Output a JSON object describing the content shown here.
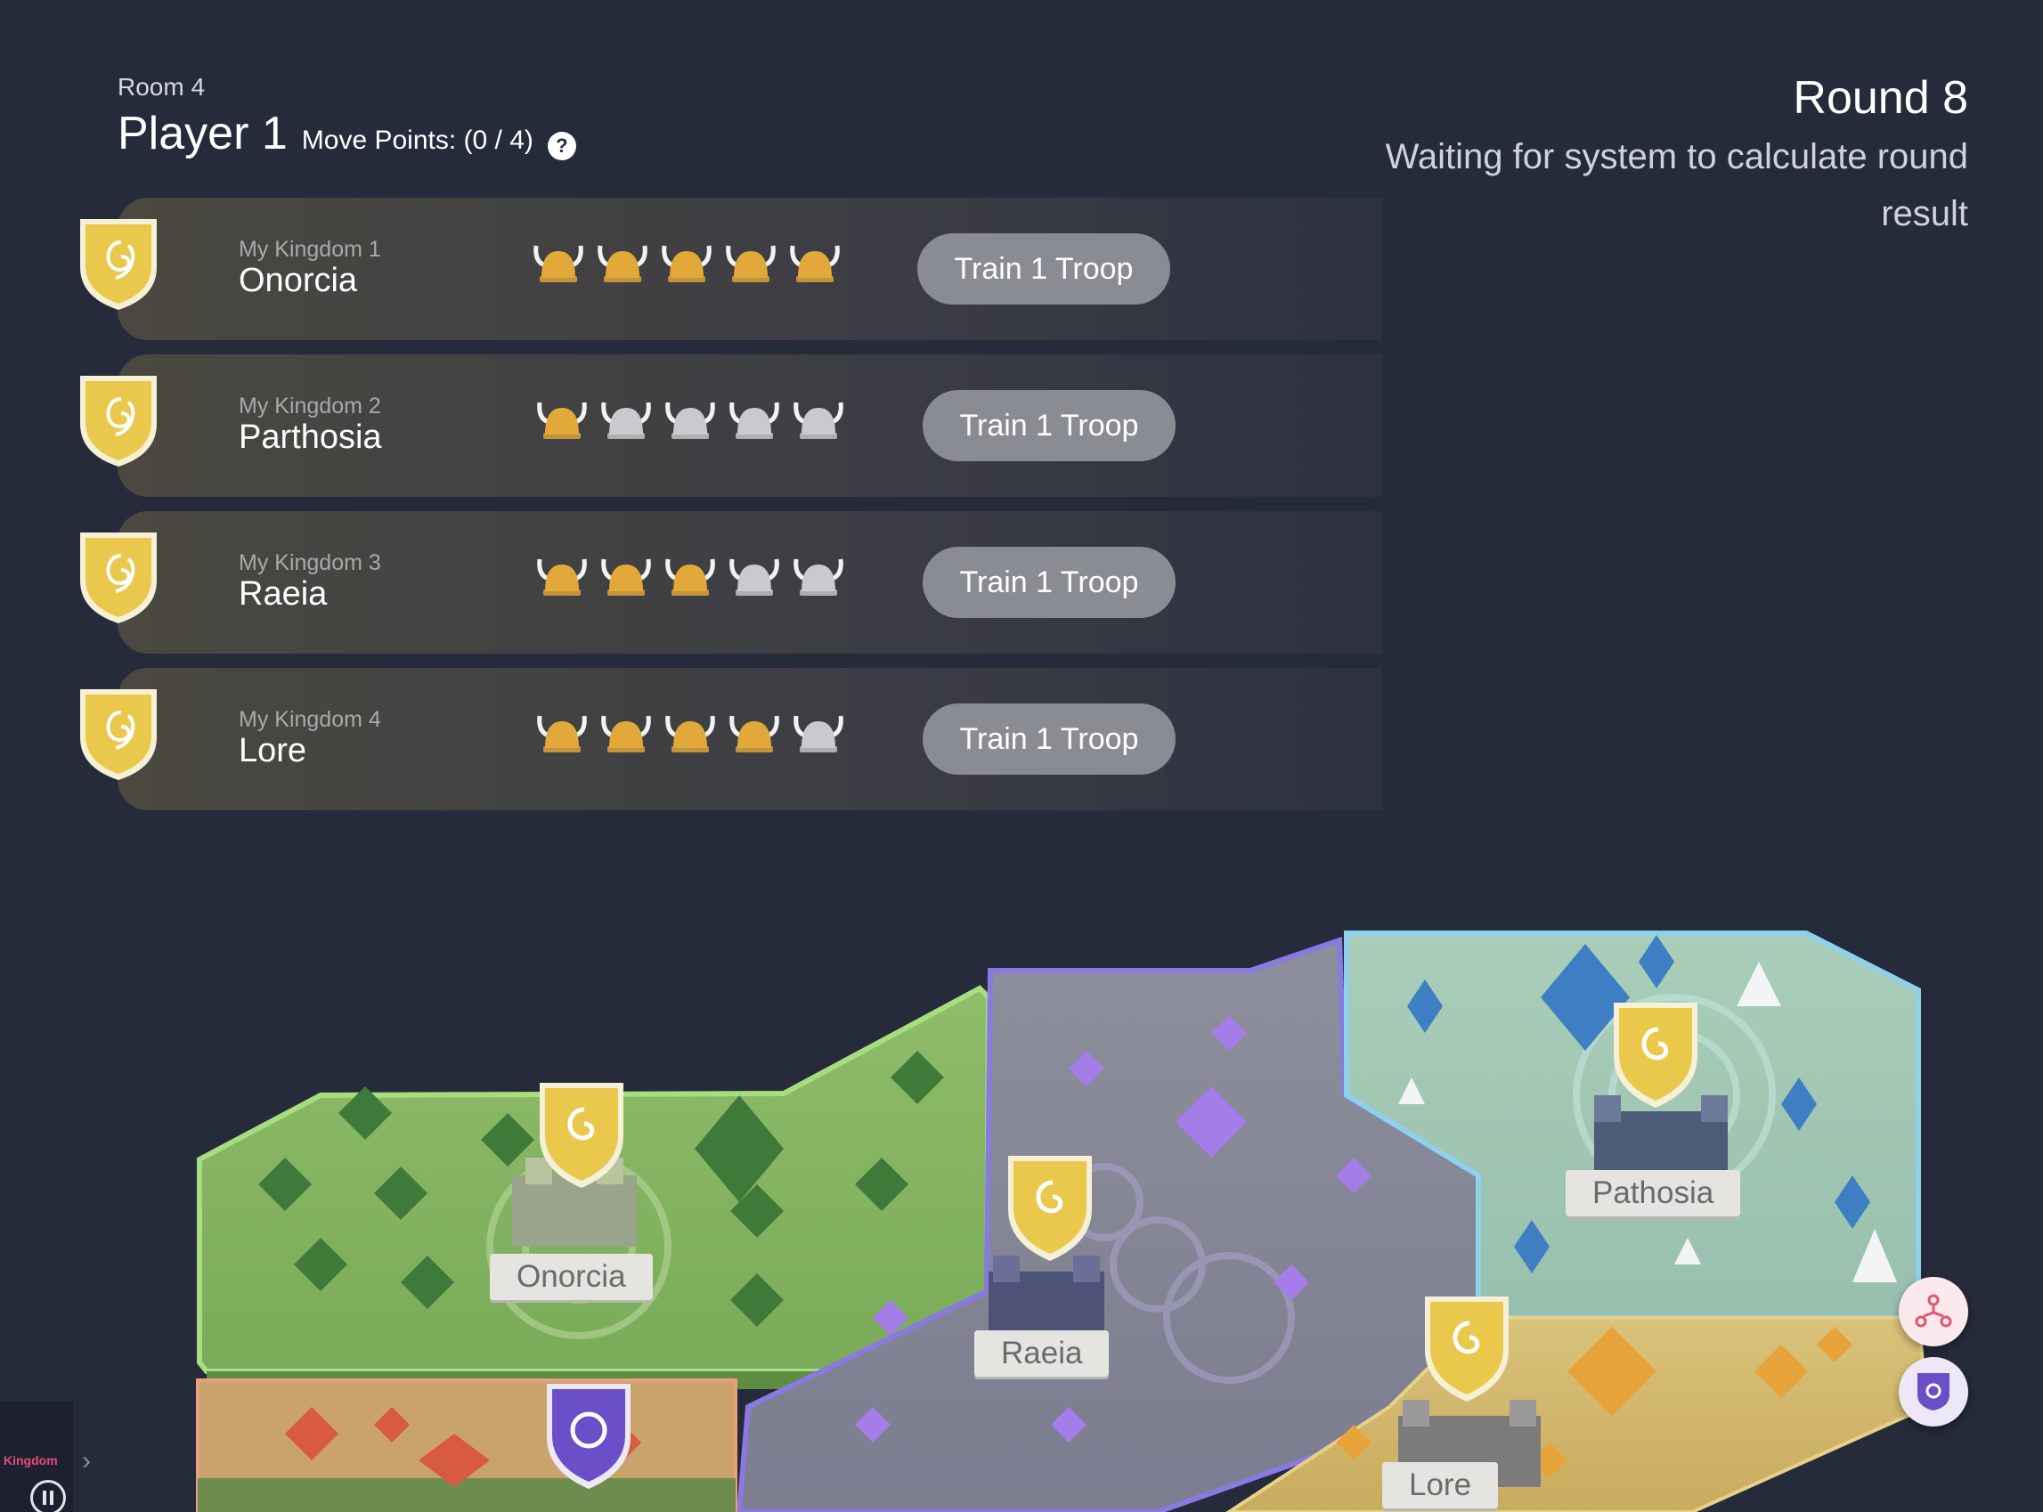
{
  "header": {
    "room": "Room 4",
    "player": "Player 1",
    "move_points": "Move Points: (0 / 4)",
    "help": "?"
  },
  "round": {
    "title": "Round 8",
    "status": "Waiting for system to calculate round result"
  },
  "kingdoms": [
    {
      "sub": "My Kingdom 1",
      "name": "Onorcia",
      "troops_filled": 5,
      "troops_total": 5,
      "button": "Train 1 Troop"
    },
    {
      "sub": "My Kingdom 2",
      "name": "Parthosia",
      "troops_filled": 1,
      "troops_total": 5,
      "button": "Train 1 Troop"
    },
    {
      "sub": "My Kingdom 3",
      "name": "Raeia",
      "troops_filled": 3,
      "troops_total": 5,
      "button": "Train 1 Troop"
    },
    {
      "sub": "My Kingdom 4",
      "name": "Lore",
      "troops_filled": 4,
      "troops_total": 5,
      "button": "Train 1 Troop"
    }
  ],
  "map": {
    "labels": {
      "onorcia": "Onorcia",
      "raeia": "Raeia",
      "pathosia": "Pathosia",
      "lore": "Lore"
    }
  },
  "colors": {
    "background": "#262b3b",
    "gold": "#e9c84c",
    "helmet_gold": "#e2a93a",
    "helmet_silver": "#c9cacd",
    "button": "#8a8c93",
    "enemy_purple": "#6a4fc9"
  },
  "icons": {
    "shield": "gold-shield-swirl-icon",
    "troop": "viking-helmet-icon",
    "alliance": "network-people-icon",
    "crest": "purple-crest-icon"
  },
  "branding": {
    "logo": "Kingdom"
  }
}
